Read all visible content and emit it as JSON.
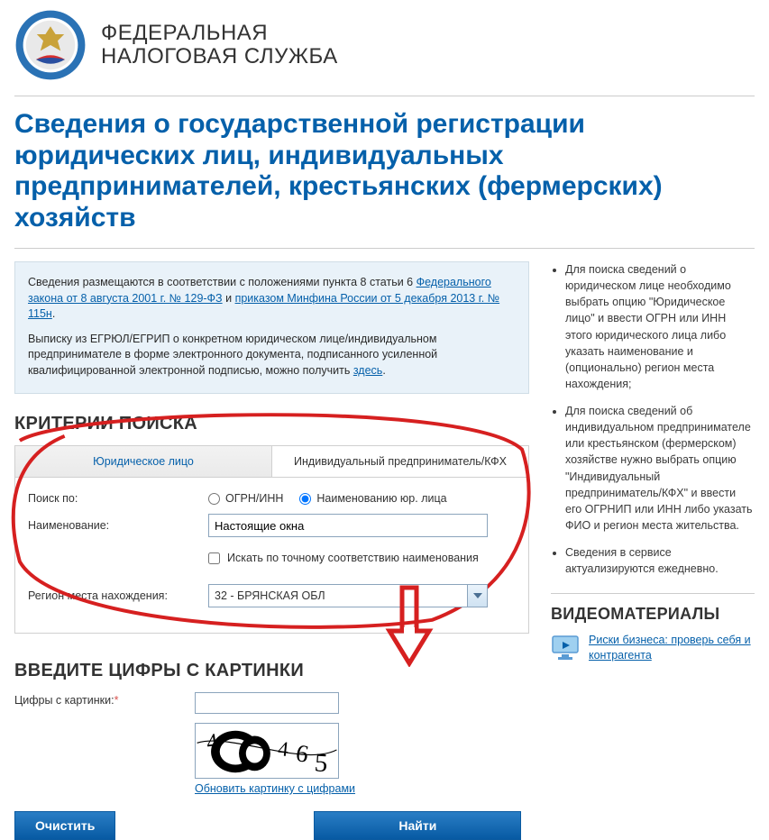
{
  "brand": {
    "line1": "ФЕДЕРАЛЬНАЯ",
    "line2": "НАЛОГОВАЯ СЛУЖБА"
  },
  "page_title": "Сведения о государственной регистрации юридических лиц, индивидуальных предпринимателей, крестьянских (фермерских) хозяйств",
  "info_panel": {
    "p1_pre": "Сведения размещаются в соответствии с положениями пункта 8 статьи 6 ",
    "link1": "Федерального закона от 8 августа 2001 г. № 129-ФЗ",
    "p1_sep": " и ",
    "link2": "приказом Минфина России от 5 декабря 2013 г. № 115н",
    "p1_post": ".",
    "p2_pre": "Выписку из ЕГРЮЛ/ЕГРИП о конкретном юридическом лице/индивидуальном предпринимателе в форме электронного документа, подписанного усиленной квалифицированной электронной подписью, можно получить ",
    "link3": "здесь",
    "p2_post": "."
  },
  "criteria": {
    "title": "КРИТЕРИИ ПОИСКА",
    "tabs": [
      {
        "label": "Юридическое лицо",
        "active": true
      },
      {
        "label": "Индивидуальный предприниматель/КФХ",
        "active": false
      }
    ],
    "search_by_label": "Поиск по:",
    "radio1": "ОГРН/ИНН",
    "radio2": "Наименованию юр. лица",
    "name_label": "Наименование:",
    "name_value": "Настоящие окна",
    "exact_match": "Искать по точному соответствию наименования",
    "region_label": "Регион места нахождения:",
    "region_value": "32 - БРЯНСКАЯ ОБЛ"
  },
  "captcha": {
    "title": "ВВЕДИТЕ ЦИФРЫ С КАРТИНКИ",
    "label": "Цифры с картинки:",
    "value": "",
    "refresh": "Обновить картинку с цифрами"
  },
  "actions": {
    "clear": "Очистить",
    "submit": "Найти"
  },
  "sidebar": {
    "bullets": [
      "Для поиска сведений о юридическом лице необходимо выбрать опцию \"Юридическое лицо\" и ввести ОГРН или ИНН этого юридического лица либо указать наименование и (опционально) регион места нахождения;",
      "Для поиска сведений об индивидуальном предпринимателе или крестьянском (фермерском) хозяйстве нужно выбрать опцию \"Индивидуальный предприниматель/КФХ\" и ввести его ОГРНИП или ИНН либо указать ФИО и регион места жительства.",
      "Сведения в сервисе актуализируются ежедневно."
    ],
    "video_title": "ВИДЕОМАТЕРИАЛЫ",
    "video_link": "Риски бизнеса: проверь себя и контрагента"
  }
}
